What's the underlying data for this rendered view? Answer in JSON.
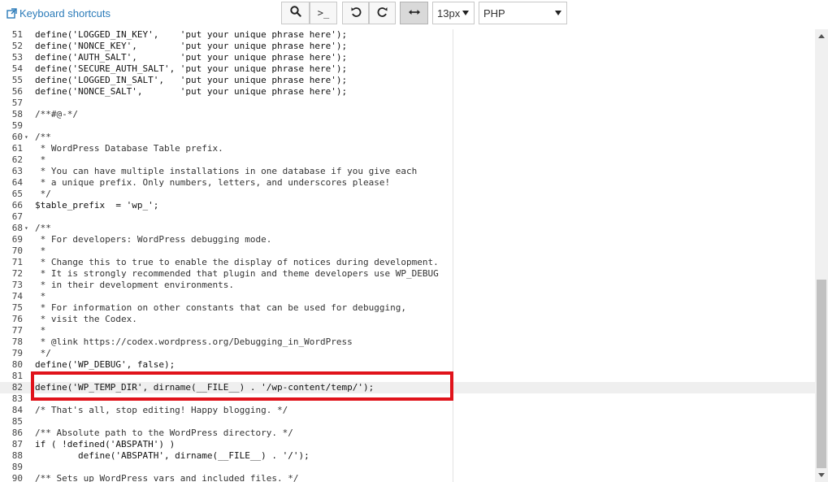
{
  "toolbar": {
    "keyboard_shortcuts_label": "Keyboard shortcuts",
    "font_size": "13px",
    "language": "PHP"
  },
  "icons": {
    "external": "external-link-icon",
    "search": "search-icon",
    "terminal": "terminal-icon",
    "undo": "undo-icon",
    "redo": "redo-icon",
    "wrap": "wrap-arrows-icon"
  },
  "colors": {
    "link": "#2b7bb9",
    "highlight_border": "#e0131b",
    "string": "#2c2cb8"
  },
  "editor": {
    "active_line": "82",
    "lines": [
      {
        "n": "51",
        "code": "define('LOGGED_IN_KEY',    'put your unique phrase here');"
      },
      {
        "n": "52",
        "code": "define('NONCE_KEY',        'put your unique phrase here');"
      },
      {
        "n": "53",
        "code": "define('AUTH_SALT',        'put your unique phrase here');"
      },
      {
        "n": "54",
        "code": "define('SECURE_AUTH_SALT', 'put your unique phrase here');"
      },
      {
        "n": "55",
        "code": "define('LOGGED_IN_SALT',   'put your unique phrase here');"
      },
      {
        "n": "56",
        "code": "define('NONCE_SALT',       'put your unique phrase here');"
      },
      {
        "n": "57",
        "code": ""
      },
      {
        "n": "58",
        "code": "/**#@-*/"
      },
      {
        "n": "59",
        "code": ""
      },
      {
        "n": "60",
        "code": "/**",
        "fold": true
      },
      {
        "n": "61",
        "code": " * WordPress Database Table prefix."
      },
      {
        "n": "62",
        "code": " *"
      },
      {
        "n": "63",
        "code": " * You can have multiple installations in one database if you give each"
      },
      {
        "n": "64",
        "code": " * a unique prefix. Only numbers, letters, and underscores please!"
      },
      {
        "n": "65",
        "code": " */"
      },
      {
        "n": "66",
        "code": "$table_prefix  = 'wp_';"
      },
      {
        "n": "67",
        "code": ""
      },
      {
        "n": "68",
        "code": "/**",
        "fold": true
      },
      {
        "n": "69",
        "code": " * For developers: WordPress debugging mode."
      },
      {
        "n": "70",
        "code": " *"
      },
      {
        "n": "71",
        "code": " * Change this to true to enable the display of notices during development."
      },
      {
        "n": "72",
        "code": " * It is strongly recommended that plugin and theme developers use WP_DEBUG"
      },
      {
        "n": "73",
        "code": " * in their development environments."
      },
      {
        "n": "74",
        "code": " *"
      },
      {
        "n": "75",
        "code": " * For information on other constants that can be used for debugging,"
      },
      {
        "n": "76",
        "code": " * visit the Codex."
      },
      {
        "n": "77",
        "code": " *"
      },
      {
        "n": "78",
        "code": " * @link https://codex.wordpress.org/Debugging_in_WordPress"
      },
      {
        "n": "79",
        "code": " */"
      },
      {
        "n": "80",
        "code": "define('WP_DEBUG', false);"
      },
      {
        "n": "81",
        "code": ""
      },
      {
        "n": "82",
        "code": "define('WP_TEMP_DIR', dirname(__FILE__) . '/wp-content/temp/');"
      },
      {
        "n": "83",
        "code": ""
      },
      {
        "n": "84",
        "code": "/* That's all, stop editing! Happy blogging. */"
      },
      {
        "n": "85",
        "code": ""
      },
      {
        "n": "86",
        "code": "/** Absolute path to the WordPress directory. */"
      },
      {
        "n": "87",
        "code": "if ( !defined('ABSPATH') )"
      },
      {
        "n": "88",
        "code": "\tdefine('ABSPATH', dirname(__FILE__) . '/');"
      },
      {
        "n": "89",
        "code": ""
      },
      {
        "n": "90",
        "code": "/** Sets up WordPress vars and included files. */"
      }
    ]
  }
}
